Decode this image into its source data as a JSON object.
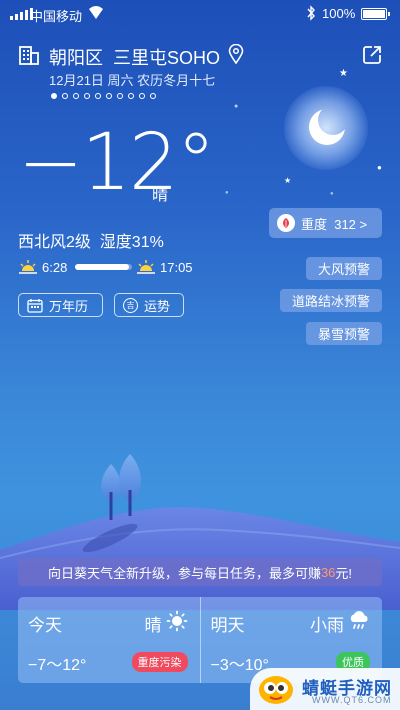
{
  "status_bar": {
    "carrier": "中国移动",
    "battery": "100%"
  },
  "header": {
    "location": "朝阳区  三里屯SOHO",
    "date": "12月21日 周六 农历冬月十七",
    "page_count": 10,
    "active_page": 1
  },
  "current": {
    "temperature": "−12°",
    "condition": "晴",
    "wind_humidity": "西北风2级  湿度31%",
    "sunrise": "6:28",
    "sunset": "17:05",
    "daylight_progress": 0.95
  },
  "buttons": {
    "calendar": "万年历",
    "fortune": "运势",
    "fortune_glyph": "吉"
  },
  "air_quality": {
    "label": "重度  312 >"
  },
  "warnings": [
    "大风预警",
    "道路结冰预警",
    "暴雪预警"
  ],
  "banner": {
    "text_before": "向日葵天气全新升级，参与每日任务，最多可赚",
    "highlight": "36",
    "text_after": "元!"
  },
  "forecast": [
    {
      "day": "今天",
      "weather": "晴",
      "icon": "sun-icon",
      "range": "−7～12°",
      "badge": "重度污染",
      "badge_color": "#ef4a5e"
    },
    {
      "day": "明天",
      "weather": "小雨",
      "icon": "rain-icon",
      "range": "−3～10°",
      "badge": "优质",
      "badge_color": "#3cc55a"
    }
  ],
  "watermark": {
    "title": "蜻蜓手游网",
    "url": "WWW.QT6.COM"
  },
  "colors": {
    "accent_red": "#ef4a5e",
    "accent_green": "#3cc55a",
    "banner_highlight": "#ff9a6a"
  }
}
